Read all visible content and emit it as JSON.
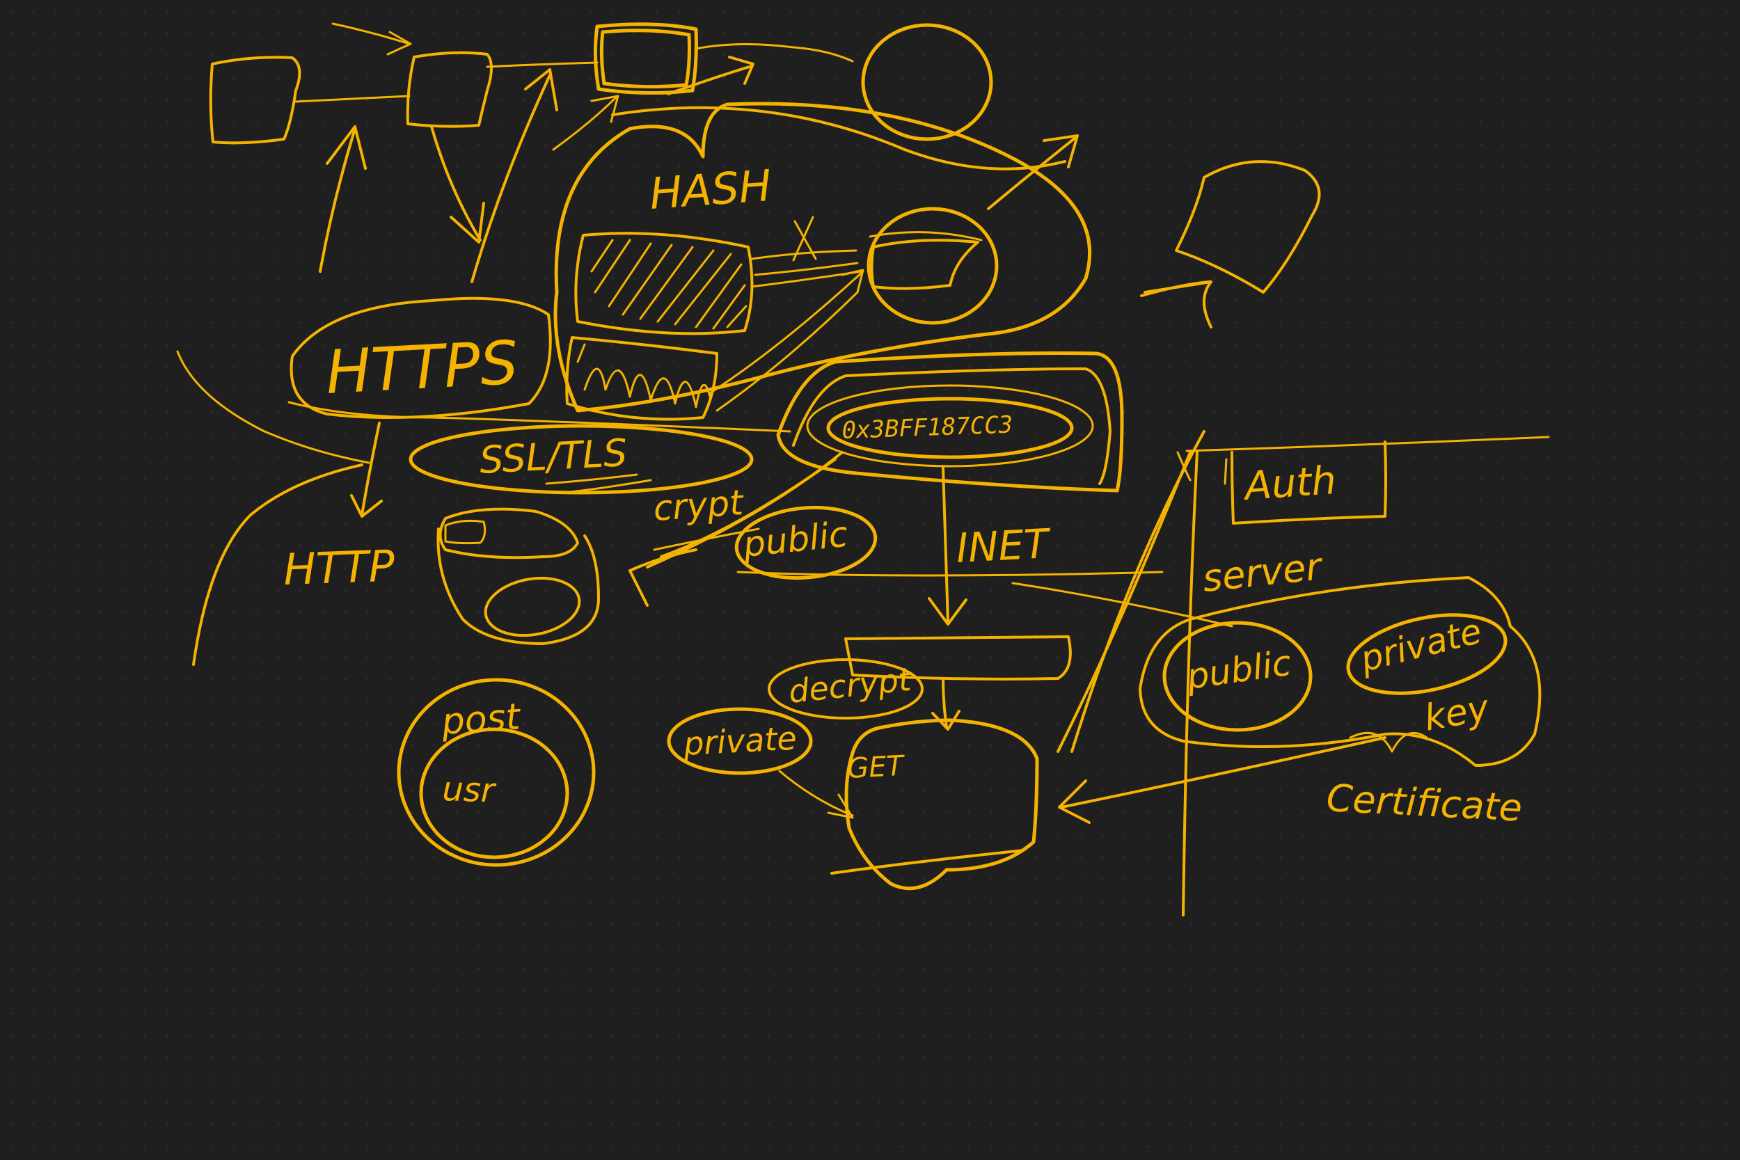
{
  "canvas": {
    "background": "#1f1f1f",
    "dot_color": "#2c2c2c",
    "ink_color": "#f5b301"
  },
  "labels": {
    "hash": "HASH",
    "https": "HTTPS",
    "http": "HTTP",
    "ssl_tls": "SSL/TLS",
    "crypt": "crypt",
    "public_left": "public",
    "hex_value": "0x3BFF187CC3",
    "inet": "INET",
    "auth": "Auth",
    "server": "server",
    "public_right": "public",
    "private_right": "private",
    "key": "key",
    "certificate": "Certificate",
    "decrypt": "decrypt",
    "private_left": "private",
    "get": "GET",
    "post": "post",
    "user": "usr"
  }
}
